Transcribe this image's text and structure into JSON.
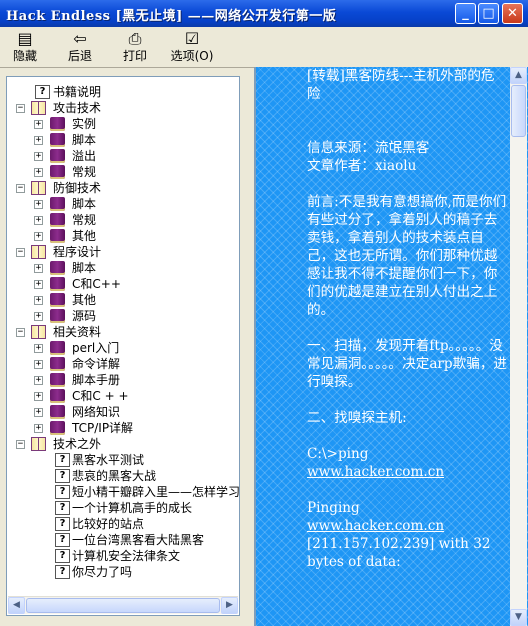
{
  "window": {
    "title": "Hack Endless [黑无止境] ——网络公开发行第一版",
    "controls": {
      "minimize": "_",
      "maximize": "□",
      "close": "✕"
    }
  },
  "toolbar": {
    "buttons": [
      {
        "label": "隐藏",
        "icon": "hide-icon",
        "glyph": "▤"
      },
      {
        "label": "后退",
        "icon": "back-arrow-icon",
        "glyph": "⇦"
      },
      {
        "label": "打印",
        "icon": "printer-icon",
        "glyph": "⎙"
      },
      {
        "label": "选项(O)",
        "icon": "options-icon",
        "glyph": "☑"
      }
    ]
  },
  "tree": {
    "nodes": [
      {
        "label": "书籍说明",
        "level": 1,
        "type": "help"
      },
      {
        "label": "攻击技术",
        "level": 0,
        "type": "openbook",
        "exp": "−"
      },
      {
        "label": "实例",
        "level": 1,
        "type": "book",
        "exp": "+"
      },
      {
        "label": "脚本",
        "level": 1,
        "type": "book",
        "exp": "+"
      },
      {
        "label": "溢出",
        "level": 1,
        "type": "book",
        "exp": "+"
      },
      {
        "label": "常规",
        "level": 1,
        "type": "book",
        "exp": "+"
      },
      {
        "label": "防御技术",
        "level": 0,
        "type": "openbook",
        "exp": "−"
      },
      {
        "label": "脚本",
        "level": 1,
        "type": "book",
        "exp": "+"
      },
      {
        "label": "常规",
        "level": 1,
        "type": "book",
        "exp": "+"
      },
      {
        "label": "其他",
        "level": 1,
        "type": "book",
        "exp": "+"
      },
      {
        "label": "程序设计",
        "level": 0,
        "type": "openbook",
        "exp": "−"
      },
      {
        "label": "脚本",
        "level": 1,
        "type": "book",
        "exp": "+"
      },
      {
        "label": "C和C++",
        "level": 1,
        "type": "book",
        "exp": "+"
      },
      {
        "label": "其他",
        "level": 1,
        "type": "book",
        "exp": "+"
      },
      {
        "label": "源码",
        "level": 1,
        "type": "book",
        "exp": "+"
      },
      {
        "label": "相关资料",
        "level": 0,
        "type": "openbook",
        "exp": "−"
      },
      {
        "label": "perl入门",
        "level": 1,
        "type": "book",
        "exp": "+"
      },
      {
        "label": "命令详解",
        "level": 1,
        "type": "book",
        "exp": "+"
      },
      {
        "label": "脚本手册",
        "level": 1,
        "type": "book",
        "exp": "+"
      },
      {
        "label": "C和C + +",
        "level": 1,
        "type": "book",
        "exp": "+"
      },
      {
        "label": "网络知识",
        "level": 1,
        "type": "book",
        "exp": "+"
      },
      {
        "label": "TCP/IP详解",
        "level": 1,
        "type": "book",
        "exp": "+"
      },
      {
        "label": "技术之外",
        "level": 0,
        "type": "openbook",
        "exp": "−"
      },
      {
        "label": "黑客水平测试",
        "level": 2,
        "type": "help"
      },
      {
        "label": "悲哀的黑客大战",
        "level": 2,
        "type": "help"
      },
      {
        "label": "短小精干瓣辟入里——怎样学习",
        "level": 2,
        "type": "help"
      },
      {
        "label": "一个计算机高手的成长",
        "level": 2,
        "type": "help"
      },
      {
        "label": "比较好的站点",
        "level": 2,
        "type": "help"
      },
      {
        "label": "一位台湾黑客看大陆黑客",
        "level": 2,
        "type": "help"
      },
      {
        "label": "计算机安全法律条文",
        "level": 2,
        "type": "help"
      },
      {
        "label": "你尽力了吗",
        "level": 2,
        "type": "help"
      }
    ]
  },
  "article": {
    "lines": [
      {
        "text": "[转载]黑客防线---主机外部的危险"
      },
      {
        "text": ""
      },
      {
        "text": ""
      },
      {
        "text": "信息来源：流氓黑客"
      },
      {
        "text": "文章作者：xiaolu"
      },
      {
        "text": ""
      },
      {
        "text": "前言:不是我有意想搞你,而是你们有些过分了，拿着别人的稿子去卖钱，拿着别人的技术装点自己，这也无所谓。你们那种优越感让我不得不提醒你们一下，你们的优越是建立在别人付出之上的。"
      },
      {
        "text": ""
      },
      {
        "text": "一、扫描，发现开着ftp。。。。。没常见漏洞。。。。。决定arp欺骗，进行嗅探。"
      },
      {
        "text": ""
      },
      {
        "text": "二、找嗅探主机:"
      },
      {
        "text": ""
      },
      {
        "text": "C:\\>ping"
      },
      {
        "text": "www.hacker.com.cn",
        "link": true
      },
      {
        "text": ""
      },
      {
        "text": "Pinging"
      },
      {
        "text": "www.hacker.com.cn",
        "link": true
      },
      {
        "text": "[211.157.102.239] with 32 bytes of data:"
      }
    ]
  },
  "scroll": {
    "left_arrow": "◀",
    "right_arrow": "▶",
    "up_arrow": "▲",
    "down_arrow": "▼"
  }
}
